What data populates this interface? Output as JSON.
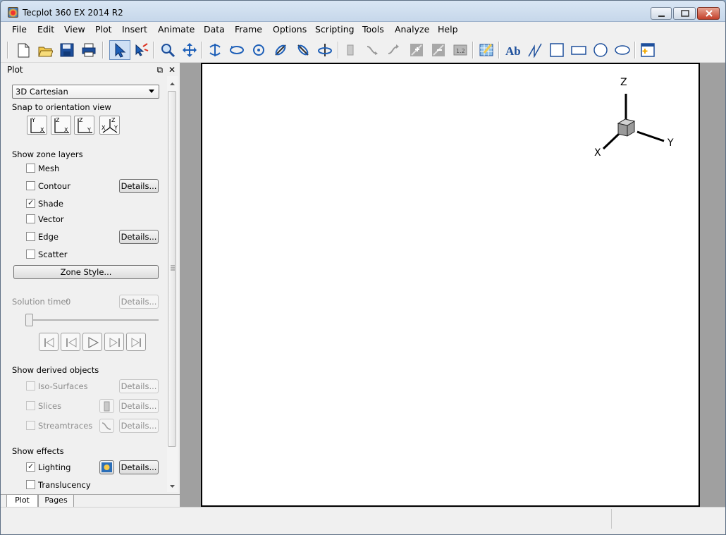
{
  "window": {
    "title": "Tecplot 360 EX 2014 R2"
  },
  "menu": [
    "File",
    "Edit",
    "View",
    "Plot",
    "Insert",
    "Animate",
    "Data",
    "Frame",
    "Options",
    "Scripting",
    "Tools",
    "Analyze",
    "Help"
  ],
  "panel": {
    "title": "Plot",
    "plot_type": "3D Cartesian",
    "snap_label": "Snap to orientation view",
    "zone_layers_label": "Show zone layers",
    "layers": [
      {
        "label": "Mesh",
        "checked": false
      },
      {
        "label": "Contour",
        "checked": false
      },
      {
        "label": "Shade",
        "checked": true
      },
      {
        "label": "Vector",
        "checked": false
      },
      {
        "label": "Edge",
        "checked": false
      },
      {
        "label": "Scatter",
        "checked": false
      }
    ],
    "details_label": "Details...",
    "zone_style_label": "Zone Style...",
    "solution_time_label": "Solution time:",
    "solution_time_value": "0",
    "derived_label": "Show derived objects",
    "derived": [
      "Iso-Surfaces",
      "Slices",
      "Streamtraces"
    ],
    "effects_label": "Show effects",
    "effects": [
      {
        "label": "Lighting",
        "checked": true
      },
      {
        "label": "Translucency",
        "checked": false
      }
    ]
  },
  "tabs": [
    "Plot",
    "Pages"
  ],
  "axes": {
    "x": "X",
    "y": "Y",
    "z": "Z"
  }
}
